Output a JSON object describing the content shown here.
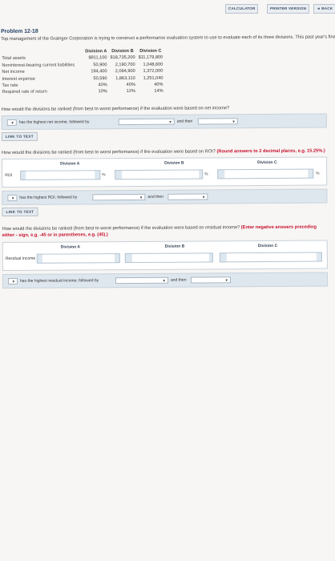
{
  "toolbar": {
    "calculator": "CALCULATOR",
    "printer": "PRINTER VERSION",
    "back": "◄ BACK"
  },
  "problem": {
    "title": "Problem 12-18",
    "intro": "Top management of the Grainger Corporation is trying to construct a performance evaluation system to use to evaluate each of its three divisions. This past year's financial data are as follows:"
  },
  "financials": {
    "headers": [
      "Division A",
      "Division B",
      "Division C"
    ],
    "rows": [
      {
        "label": "Total assets",
        "values": [
          "$911,100",
          "$18,735,200",
          "$11,179,800"
        ]
      },
      {
        "label": "Noninterest-bearing current liabilities",
        "values": [
          "50,900",
          "2,190,700",
          "1,048,600"
        ]
      },
      {
        "label": "Net income",
        "values": [
          "194,400",
          "2,094,900",
          "1,372,000"
        ]
      },
      {
        "label": "Interest expense",
        "values": [
          "50,590",
          "1,863,110",
          "1,251,040"
        ]
      },
      {
        "label": "Tax rate",
        "values": [
          "40%",
          "40%",
          "40%"
        ]
      },
      {
        "label": "Required rate of return",
        "values": [
          "10%",
          "12%",
          "14%"
        ]
      }
    ]
  },
  "q1": {
    "question": "How would the divisions be ranked (from best to worst performance) if the evaluation were based on net income?",
    "selection_1": "has the highest net income, followed by",
    "and_then": "and then",
    "link": "LINK TO TEXT"
  },
  "q2": {
    "question": "How would the divisions be ranked (from best to worst performance) if the evaluation were based on ROI?",
    "instruction": "(Round answers to 2 decimal places, e.g. 15.25%.)",
    "headers": [
      "Division A",
      "Division B",
      "Division C"
    ],
    "row_label": "ROI",
    "unit": "%",
    "selection_1": "has the highest ROI, followed by",
    "and_then": "and then",
    "link": "LINK TO TEXT"
  },
  "q3": {
    "question": "How would the divisions be ranked (from best to worst performance) if the evaluation were based on residual income?",
    "instruction": "(Enter negative answers preceding either - sign, e.g. -45 or in parentheses, e.g. (45).)",
    "headers": [
      "Division A",
      "Division B",
      "Division C"
    ],
    "row_label": "Residual Income",
    "selection_1": "has the highest residual income, followed by",
    "and_then": "and then"
  },
  "colors": {
    "accent": "#1d3d63",
    "answer_bg": "#dfe7ee",
    "instruction_red": "#c8102e"
  }
}
